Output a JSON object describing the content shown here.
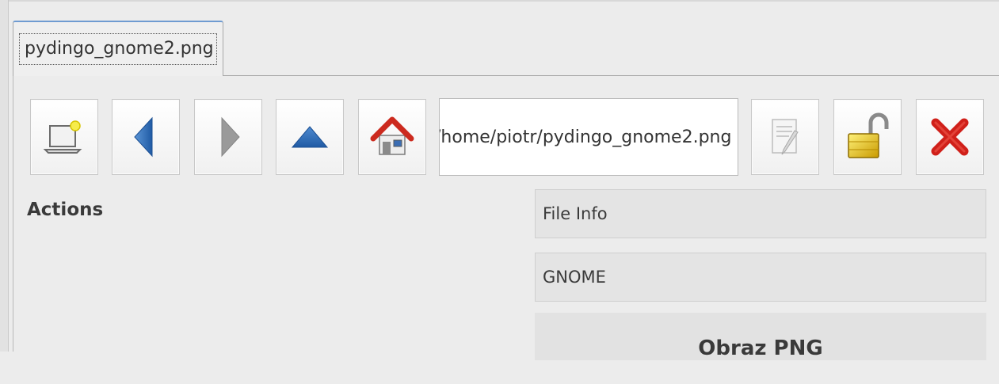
{
  "tabs": [
    {
      "label": "pydingo_gnome2.png",
      "active": true
    }
  ],
  "toolbar": {
    "buttons": [
      {
        "name": "new-window",
        "icon": "laptop-with-light-icon"
      },
      {
        "name": "back",
        "icon": "arrow-left-icon"
      },
      {
        "name": "forward",
        "icon": "arrow-right-icon",
        "disabled": true
      },
      {
        "name": "up",
        "icon": "arrow-up-icon"
      },
      {
        "name": "home",
        "icon": "home-icon"
      },
      {
        "name": "edit",
        "icon": "edit-document-icon",
        "disabled": true
      },
      {
        "name": "unlock",
        "icon": "padlock-open-icon"
      },
      {
        "name": "close",
        "icon": "close-x-icon"
      }
    ],
    "path_value": "/home/piotr/pydingo_gnome2.png"
  },
  "actions": {
    "heading": "Actions"
  },
  "info": {
    "file_info": "File Info",
    "desktop": "GNOME",
    "file_type": "Obraz PNG"
  },
  "colors": {
    "tab_accent": "#6f9bd1",
    "arrow_blue": "#2f6db5",
    "home_red": "#cc2a1e",
    "close_red": "#d0201a",
    "lock_gold": "#e0b400"
  }
}
